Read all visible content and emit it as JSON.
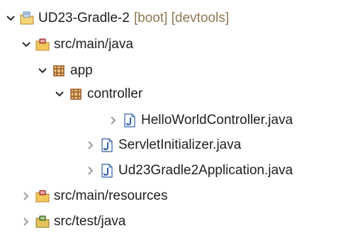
{
  "tree": {
    "project": {
      "label": "UD23-Gradle-2",
      "decorations": "[boot] [devtools]"
    },
    "src_main_java": {
      "label": "src/main/java"
    },
    "pkg_app": {
      "label": "app"
    },
    "pkg_controller": {
      "label": "controller"
    },
    "file_helloworld": {
      "label": "HelloWorldController.java"
    },
    "file_servlet": {
      "label": "ServletInitializer.java"
    },
    "file_application": {
      "label": "Ud23Gradle2Application.java"
    },
    "src_main_resources": {
      "label": "src/main/resources"
    },
    "src_test_java": {
      "label": "src/test/java"
    }
  },
  "icons": {
    "expanded": "chevron-down-icon",
    "collapsed": "chevron-right-icon",
    "project": "project-folder-icon",
    "source_folder": "source-folder-icon",
    "package": "package-icon",
    "java_file": "java-file-icon",
    "test_folder": "test-source-folder-icon"
  },
  "colors": {
    "text": "#1e1e1e",
    "decoration": "#8f7a55",
    "chevron_expanded": "#2b2b2b",
    "chevron_collapsed": "#9a9a9a",
    "folder": "#e8b64a",
    "package": "#9a5a2a",
    "java": "#2f5da8",
    "test_folder": "#5a8f2a"
  }
}
